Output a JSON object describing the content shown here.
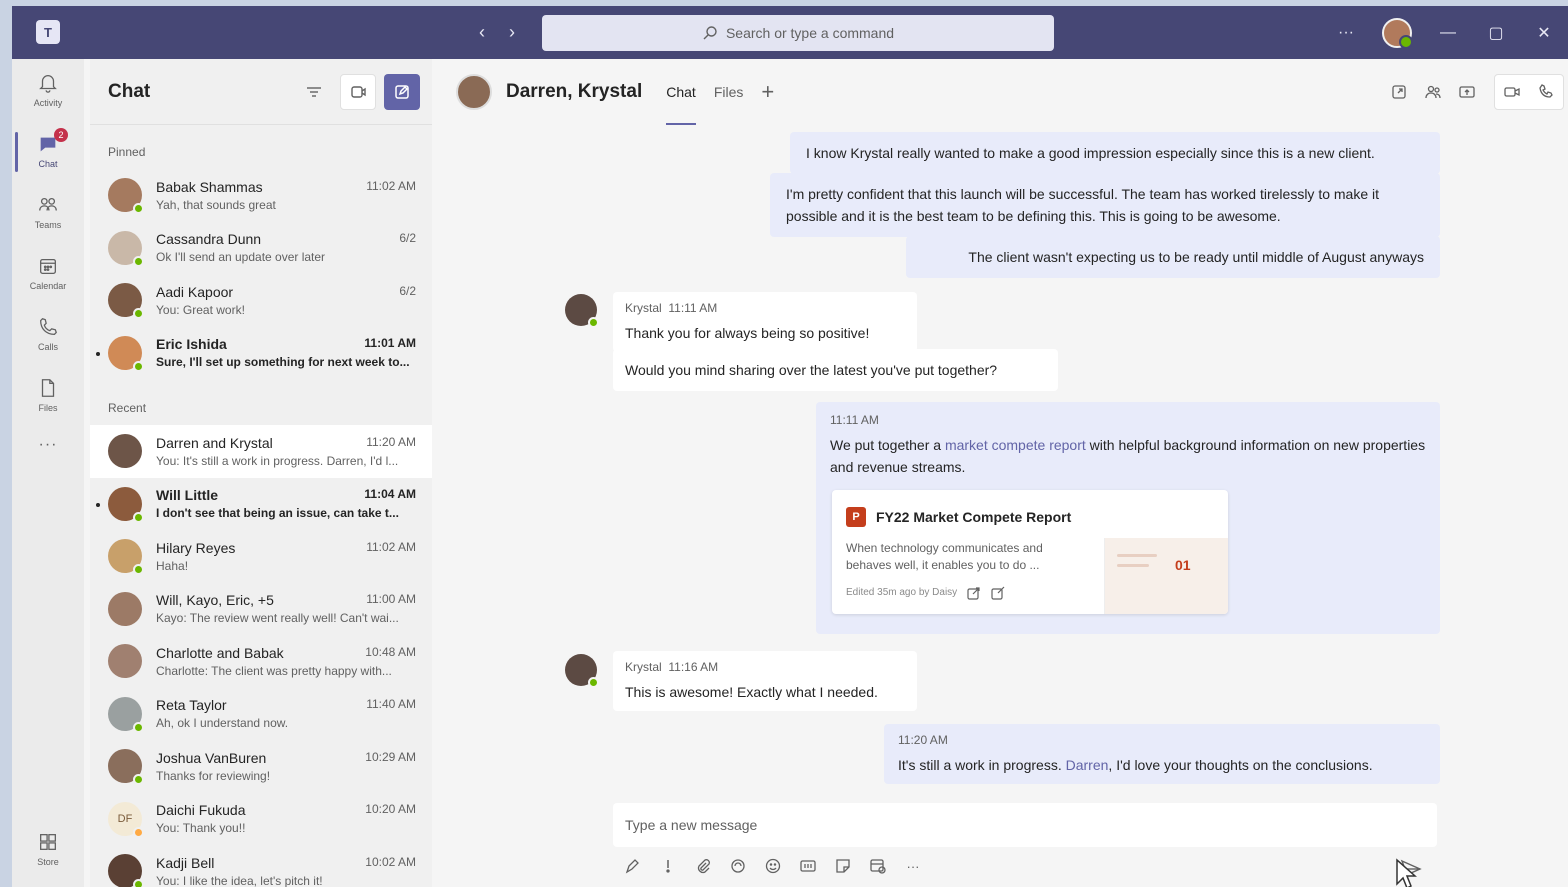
{
  "titlebar": {
    "search_placeholder": "Search or type a command",
    "more": "···"
  },
  "rail": {
    "items": [
      {
        "label": "Activity",
        "icon": "bell-icon"
      },
      {
        "label": "Chat",
        "icon": "chat-icon",
        "badge": "2"
      },
      {
        "label": "Teams",
        "icon": "teams-icon"
      },
      {
        "label": "Calendar",
        "icon": "calendar-icon"
      },
      {
        "label": "Calls",
        "icon": "phone-icon"
      },
      {
        "label": "Files",
        "icon": "file-icon"
      }
    ],
    "more": "···",
    "store": "Store"
  },
  "chatlist": {
    "title": "Chat",
    "pinned_label": "Pinned",
    "recent_label": "Recent",
    "pinned": [
      {
        "name": "Babak Shammas",
        "time": "11:02 AM",
        "preview": "Yah, that sounds great",
        "avatar_color": "#a57a5f",
        "presence": "available"
      },
      {
        "name": "Cassandra Dunn",
        "time": "6/2",
        "preview": "Ok I'll send an update over later",
        "avatar_color": "#c9b8a8",
        "presence": "available"
      },
      {
        "name": "Aadi Kapoor",
        "time": "6/2",
        "preview": "You: Great work!",
        "avatar_color": "#7b5a45",
        "presence": "available"
      },
      {
        "name": "Eric Ishida",
        "time": "11:01 AM",
        "preview": "Sure, I'll set up something for next week to...",
        "avatar_color": "#d08a56",
        "presence": "available",
        "unread": true
      }
    ],
    "recent": [
      {
        "name": "Darren and Krystal",
        "time": "11:20 AM",
        "preview": "You: It's still a work in progress. Darren, I'd l...",
        "avatar_color": "#6d5548",
        "presence": "none",
        "selected": true
      },
      {
        "name": "Will Little",
        "time": "11:04 AM",
        "preview": "I don't see that being an issue, can take t...",
        "avatar_color": "#8c5b3d",
        "presence": "available",
        "unread": true
      },
      {
        "name": "Hilary Reyes",
        "time": "11:02 AM",
        "preview": "Haha!",
        "avatar_color": "#c8a06a",
        "presence": "available"
      },
      {
        "name": "Will, Kayo, Eric, +5",
        "time": "11:00 AM",
        "preview": "Kayo: The review went really well! Can't wai...",
        "avatar_color": "#9c7a66",
        "presence": "none"
      },
      {
        "name": "Charlotte and Babak",
        "time": "10:48 AM",
        "preview": "Charlotte: The client was pretty happy with...",
        "avatar_color": "#a08070",
        "presence": "none"
      },
      {
        "name": "Reta Taylor",
        "time": "11:40 AM",
        "preview": "Ah, ok I understand now.",
        "avatar_color": "#9aa0a0",
        "presence": "available"
      },
      {
        "name": "Joshua VanBuren",
        "time": "10:29 AM",
        "preview": "Thanks for reviewing!",
        "avatar_color": "#8a6e5c",
        "presence": "available"
      },
      {
        "name": "Daichi Fukuda",
        "time": "10:20 AM",
        "preview": "You: Thank you!!",
        "avatar_color": "#f3ead6",
        "presence": "away",
        "initials": "DF"
      },
      {
        "name": "Kadji Bell",
        "time": "10:02 AM",
        "preview": "You: I like the idea, let's pitch it!",
        "avatar_color": "#5a4034",
        "presence": "available"
      }
    ]
  },
  "conversation": {
    "title": "Darren, Krystal",
    "tabs": [
      "Chat",
      "Files"
    ],
    "active_tab": "Chat",
    "messages": {
      "m1": "I know Krystal really wanted to make a good impression especially since this is a new client.",
      "m2": "I'm pretty confident that this launch will be successful. The team has worked tirelessly to make it possible and it is the best team to be defining this. This is going to be awesome.",
      "m3": "The client wasn't expecting us to be ready until middle of August anyways",
      "k1_sender": "Krystal",
      "k1_time": "11:11 AM",
      "k1_text": "Thank you for always being so positive!",
      "k2_text": "Would you mind sharing over the latest you've put together?",
      "m4_time": "11:11 AM",
      "m4_pre": "We put together a ",
      "m4_link": "market compete report",
      "m4_post": " with helpful background information on new properties and revenue streams.",
      "k3_sender": "Krystal",
      "k3_time": "11:16 AM",
      "k3_text": "This is awesome! Exactly what I needed.",
      "m5_time": "11:20 AM",
      "m5_pre": "It's still a work in progress. ",
      "m5_link": "Darren",
      "m5_post": ", I'd love your thoughts on the conclusions."
    },
    "file_card": {
      "title": "FY22 Market Compete Report",
      "description": "When technology communicates and behaves well, it enables you to do ...",
      "footer": "Edited 35m ago by Daisy",
      "thumb_number": "01"
    },
    "compose_placeholder": "Type a new message",
    "compose_more": "···"
  }
}
